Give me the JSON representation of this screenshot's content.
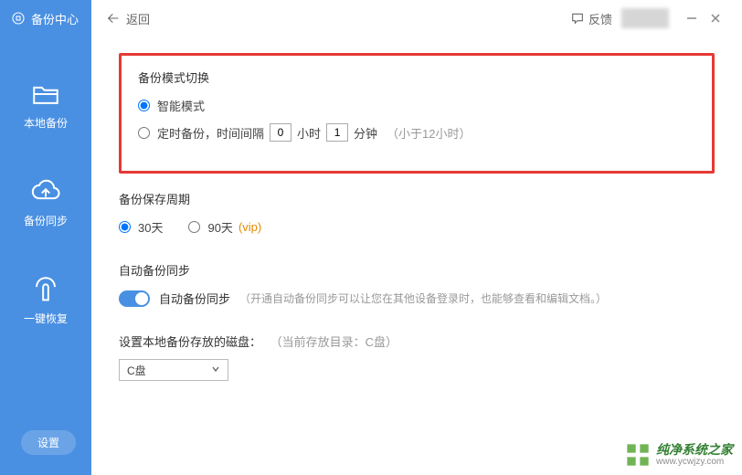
{
  "sidebar": {
    "header": "备份中心",
    "items": [
      {
        "label": "本地备份"
      },
      {
        "label": "备份同步"
      },
      {
        "label": "一键恢复"
      }
    ],
    "settings": "设置"
  },
  "topbar": {
    "back": "返回",
    "feedback": "反馈"
  },
  "mode_switch": {
    "title": "备份模式切换",
    "smart": "智能模式",
    "timed_prefix": "定时备份，时间间隔",
    "hours_value": "0",
    "hours_unit": "小时",
    "minutes_value": "1",
    "minutes_unit": "分钟",
    "hint": "（小于12小时）"
  },
  "retention": {
    "title": "备份保存周期",
    "opt30": "30天",
    "opt90": "90天",
    "vip": "(vip)"
  },
  "autosync": {
    "title": "自动备份同步",
    "toggle_label": "自动备份同步",
    "desc": "（开通自动备份同步可以让您在其他设备登录时，也能够查看和编辑文档。）"
  },
  "disk": {
    "label": "设置本地备份存放的磁盘：",
    "hint": "（当前存放目录：C盘）",
    "selected": "C盘"
  },
  "watermark": {
    "name": "纯净系统之家",
    "url": "www.ycwjzy.com"
  }
}
